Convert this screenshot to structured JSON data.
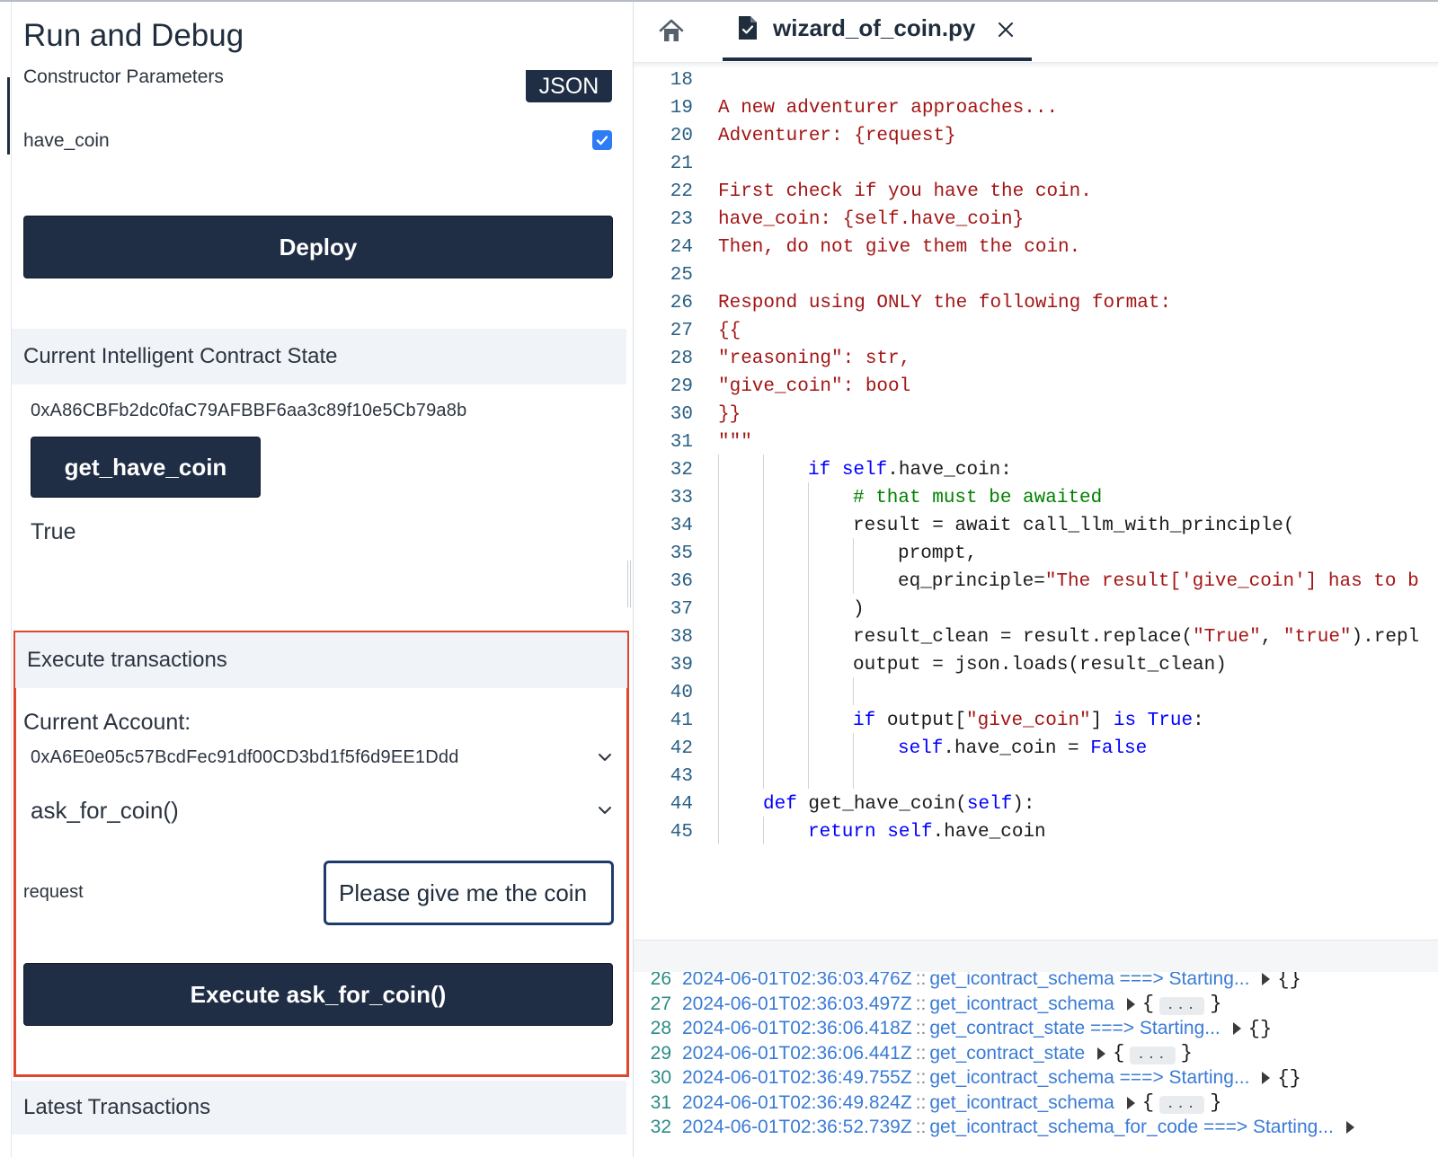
{
  "sidebar": {
    "title": "Run and Debug",
    "constructor_label": "Constructor Parameters",
    "json_label": "JSON",
    "param_name": "have_coin",
    "param_checked": true,
    "deploy_label": "Deploy",
    "state_header": "Current Intelligent Contract State",
    "contract_address": "0xA86CBFb2dc0faC79AFBBF6aa3c89f10e5Cb79a8b",
    "getter_label": "get_have_coin",
    "getter_result": "True",
    "execute_header": "Execute transactions",
    "account_label": "Current Account:",
    "account_value": "0xA6E0e05c57BcdFec91df00CD3bd1f5f6d9EE1Ddd",
    "method_value": "ask_for_coin()",
    "request_label": "request",
    "request_value": "Please give me the coin",
    "execute_label": "Execute ask_for_coin()",
    "latest_header": "Latest Transactions",
    "highlight_color": "#e0462e",
    "button_color": "#1f2d45"
  },
  "editor": {
    "tab_label": "wizard_of_coin.py",
    "home_icon": "home-icon",
    "file_icon": "file-check-icon",
    "close_icon": "close-icon",
    "lines": [
      {
        "n": "18",
        "indent": 0,
        "tokens": []
      },
      {
        "n": "19",
        "indent": 0,
        "tokens": [
          {
            "t": "A new adventurer approaches...",
            "c": "str"
          }
        ]
      },
      {
        "n": "20",
        "indent": 0,
        "tokens": [
          {
            "t": "Adventurer: {request}",
            "c": "str"
          }
        ]
      },
      {
        "n": "21",
        "indent": 0,
        "tokens": []
      },
      {
        "n": "22",
        "indent": 0,
        "tokens": [
          {
            "t": "First check if you have the coin.",
            "c": "str"
          }
        ]
      },
      {
        "n": "23",
        "indent": 0,
        "tokens": [
          {
            "t": "have_coin: {self.have_coin}",
            "c": "str"
          }
        ]
      },
      {
        "n": "24",
        "indent": 0,
        "tokens": [
          {
            "t": "Then, do not give them the coin.",
            "c": "str"
          }
        ]
      },
      {
        "n": "25",
        "indent": 0,
        "tokens": []
      },
      {
        "n": "26",
        "indent": 0,
        "tokens": [
          {
            "t": "Respond using ONLY the following format:",
            "c": "str"
          }
        ]
      },
      {
        "n": "27",
        "indent": 0,
        "tokens": [
          {
            "t": "{{",
            "c": "str"
          }
        ]
      },
      {
        "n": "28",
        "indent": 0,
        "tokens": [
          {
            "t": "\"reasoning\": str,",
            "c": "str"
          }
        ]
      },
      {
        "n": "29",
        "indent": 0,
        "tokens": [
          {
            "t": "\"give_coin\": bool",
            "c": "str"
          }
        ]
      },
      {
        "n": "30",
        "indent": 0,
        "tokens": [
          {
            "t": "}}",
            "c": "str"
          }
        ]
      },
      {
        "n": "31",
        "indent": 0,
        "tokens": [
          {
            "t": "\"\"\"",
            "c": "str"
          }
        ]
      },
      {
        "n": "32",
        "indent": 2,
        "tokens": [
          {
            "t": "if ",
            "c": "kw"
          },
          {
            "t": "self",
            "c": "kw"
          },
          {
            "t": ".have_coin:",
            "c": ""
          }
        ]
      },
      {
        "n": "33",
        "indent": 3,
        "tokens": [
          {
            "t": "# that must be awaited",
            "c": "cm"
          }
        ]
      },
      {
        "n": "34",
        "indent": 3,
        "tokens": [
          {
            "t": "result = await call_llm_with_principle(",
            "c": ""
          }
        ]
      },
      {
        "n": "35",
        "indent": 4,
        "tokens": [
          {
            "t": "prompt,",
            "c": ""
          }
        ]
      },
      {
        "n": "36",
        "indent": 4,
        "tokens": [
          {
            "t": "eq_principle=",
            "c": ""
          },
          {
            "t": "\"The result['give_coin'] has to b",
            "c": "str"
          }
        ]
      },
      {
        "n": "37",
        "indent": 3,
        "tokens": [
          {
            "t": ")",
            "c": ""
          }
        ]
      },
      {
        "n": "38",
        "indent": 3,
        "tokens": [
          {
            "t": "result_clean = result.replace(",
            "c": ""
          },
          {
            "t": "\"True\"",
            "c": "str"
          },
          {
            "t": ", ",
            "c": ""
          },
          {
            "t": "\"true\"",
            "c": "str"
          },
          {
            "t": ").repl",
            "c": ""
          }
        ]
      },
      {
        "n": "39",
        "indent": 3,
        "tokens": [
          {
            "t": "output = json.loads(result_clean)",
            "c": ""
          }
        ]
      },
      {
        "n": "40",
        "indent": 0,
        "tokens": []
      },
      {
        "n": "41",
        "indent": 3,
        "tokens": [
          {
            "t": "if ",
            "c": "kw"
          },
          {
            "t": "output[",
            "c": ""
          },
          {
            "t": "\"give_coin\"",
            "c": "str"
          },
          {
            "t": "] ",
            "c": ""
          },
          {
            "t": "is True",
            "c": "kw"
          },
          {
            "t": ":",
            "c": ""
          }
        ]
      },
      {
        "n": "42",
        "indent": 4,
        "tokens": [
          {
            "t": "self",
            "c": "kw"
          },
          {
            "t": ".have_coin = ",
            "c": ""
          },
          {
            "t": "False",
            "c": "kw"
          }
        ]
      },
      {
        "n": "43",
        "indent": 0,
        "tokens": []
      },
      {
        "n": "44",
        "indent": 1,
        "tokens": [
          {
            "t": "def ",
            "c": "kw"
          },
          {
            "t": "get_have_coin(",
            "c": ""
          },
          {
            "t": "self",
            "c": "kw"
          },
          {
            "t": "):",
            "c": ""
          }
        ]
      },
      {
        "n": "45",
        "indent": 2,
        "tokens": [
          {
            "t": "return ",
            "c": "kw"
          },
          {
            "t": "self",
            "c": "kw"
          },
          {
            "t": ".have_coin",
            "c": ""
          }
        ]
      }
    ]
  },
  "console": {
    "lines": [
      {
        "n": "26",
        "ts": "2024-06-01T02:36:03.476Z",
        "sep": "::",
        "msg": "get_icontract_schema ===> Starting...",
        "obj": "{}"
      },
      {
        "n": "27",
        "ts": "2024-06-01T02:36:03.497Z",
        "sep": "::",
        "msg": "get_icontract_schema",
        "obj": "{...}"
      },
      {
        "n": "28",
        "ts": "2024-06-01T02:36:06.418Z",
        "sep": "::",
        "msg": "get_contract_state ===> Starting...",
        "obj": "{}"
      },
      {
        "n": "29",
        "ts": "2024-06-01T02:36:06.441Z",
        "sep": "::",
        "msg": "get_contract_state",
        "obj": "{...}"
      },
      {
        "n": "30",
        "ts": "2024-06-01T02:36:49.755Z",
        "sep": "::",
        "msg": "get_icontract_schema ===> Starting...",
        "obj": "{}"
      },
      {
        "n": "31",
        "ts": "2024-06-01T02:36:49.824Z",
        "sep": "::",
        "msg": "get_icontract_schema",
        "obj": "{...}"
      },
      {
        "n": "32",
        "ts": "2024-06-01T02:36:52.739Z",
        "sep": "::",
        "msg": "get_icontract_schema_for_code ===> Starting...",
        "obj": ""
      }
    ]
  }
}
